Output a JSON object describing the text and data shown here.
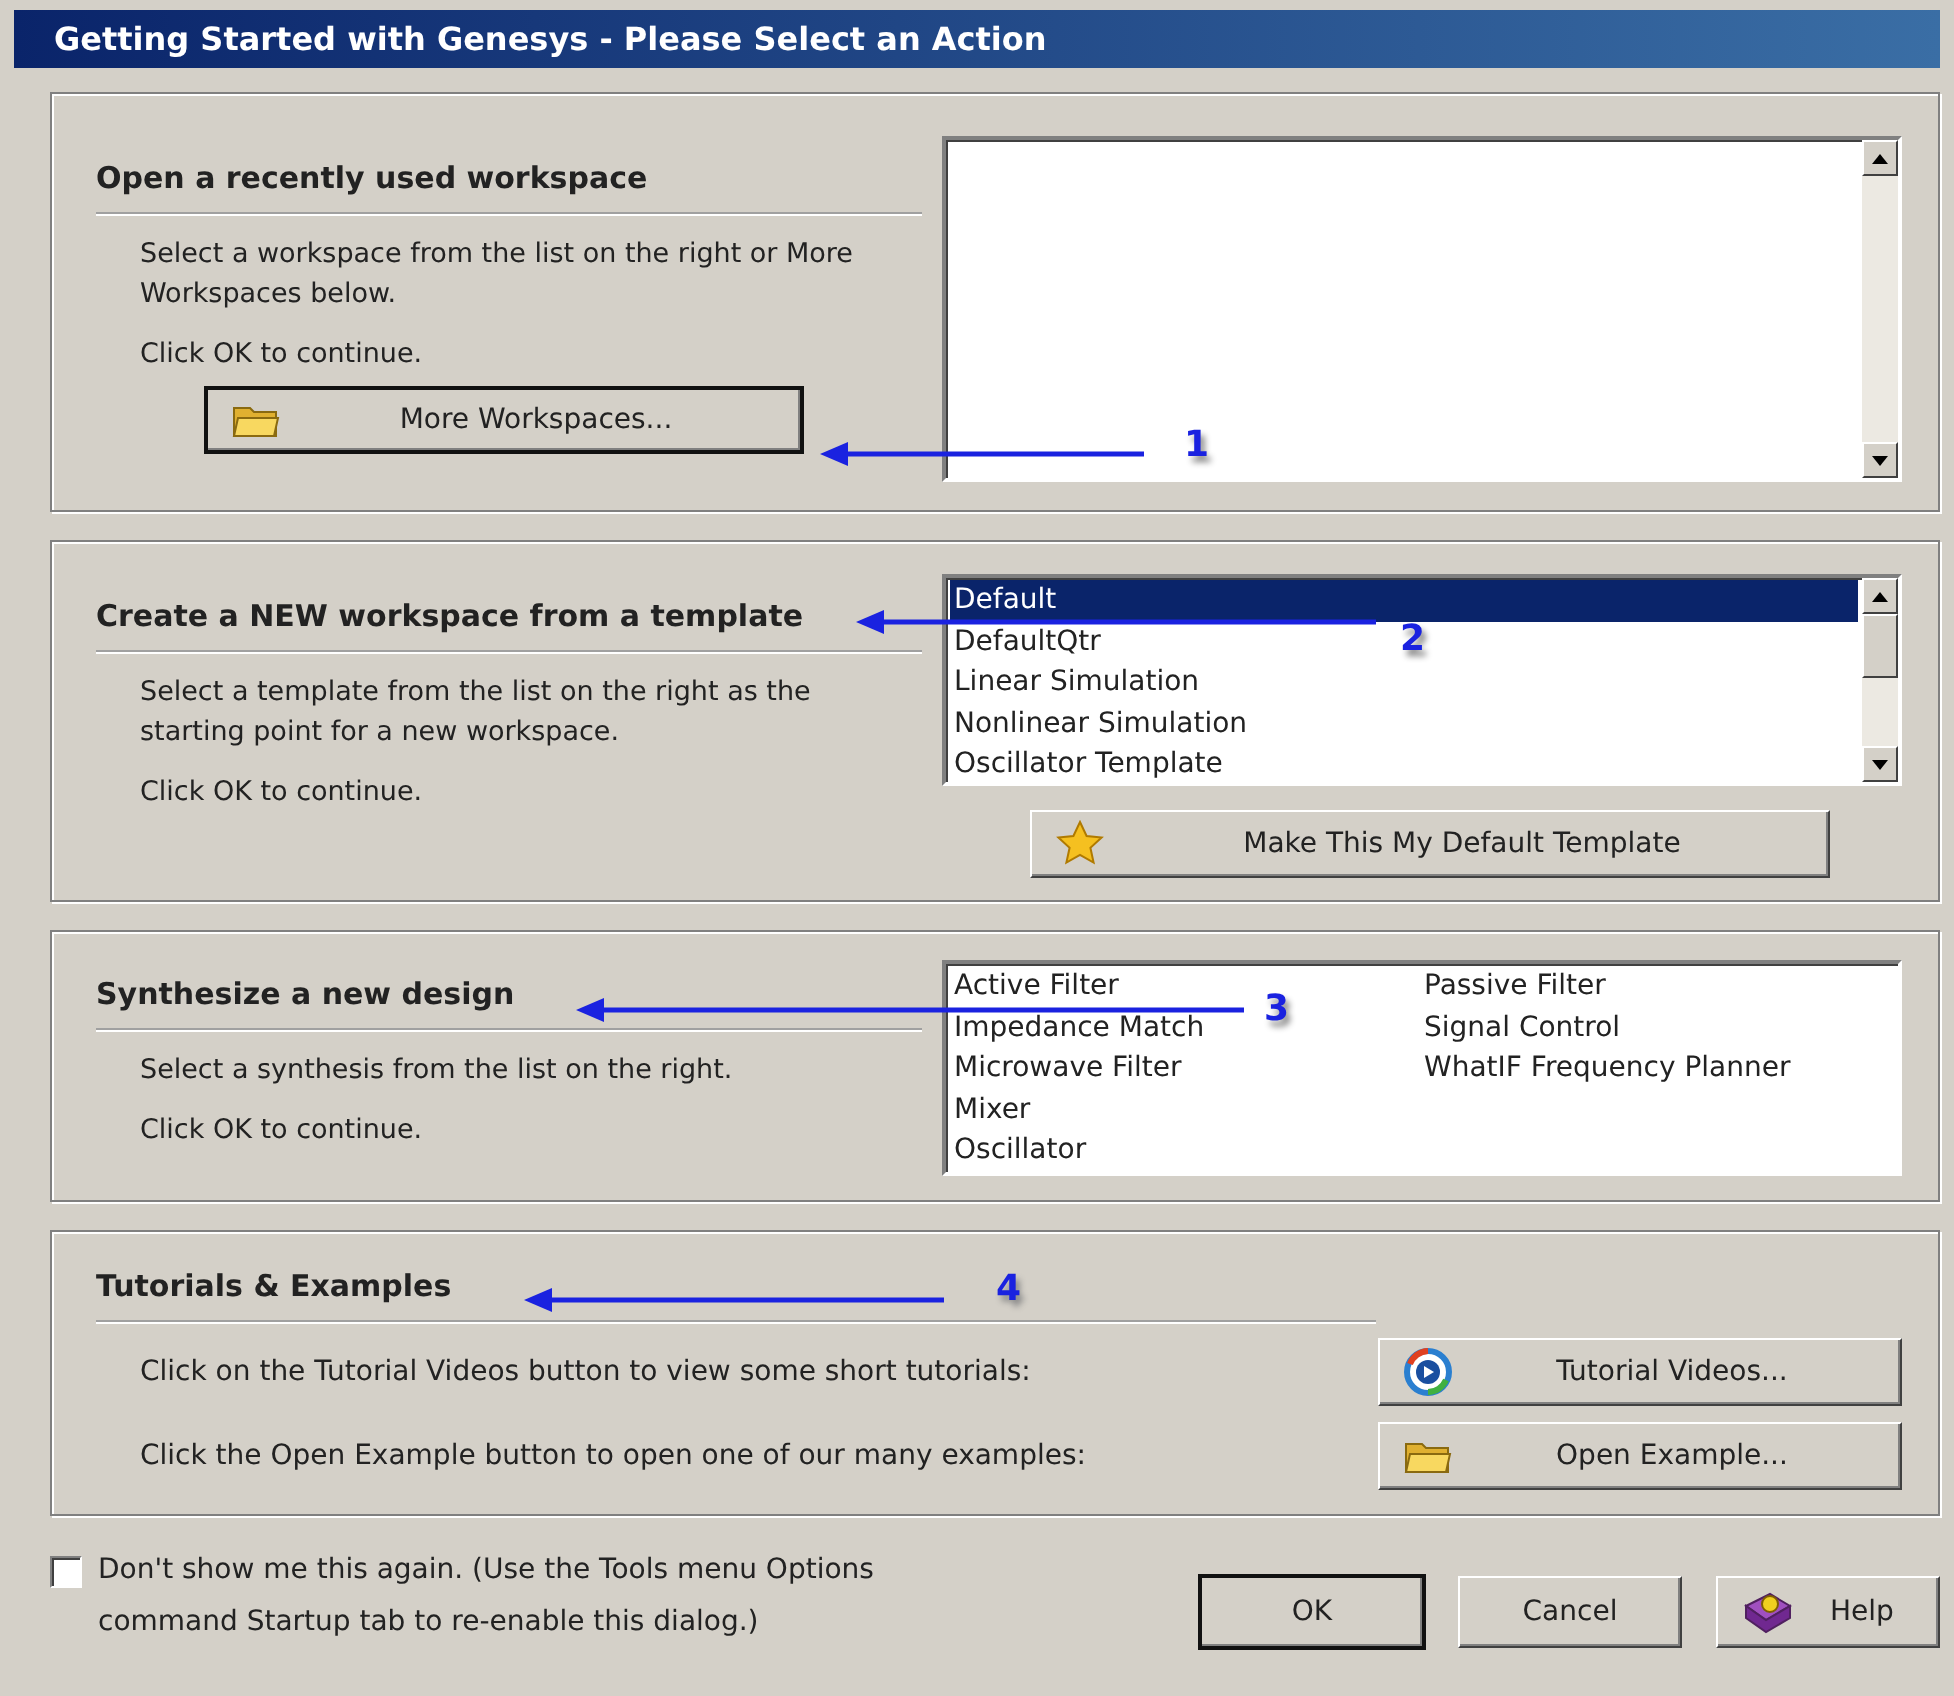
{
  "window": {
    "title": "Getting Started with Genesys - Please Select an Action"
  },
  "sections": [
    {
      "kind": "recent",
      "heading": "Open a recently used workspace",
      "lines": [
        "Select a workspace from the list on the right or More Workspaces below.",
        "Click OK to continue."
      ],
      "button": {
        "label": "More Workspaces...",
        "default": true
      },
      "annotation": "1"
    },
    {
      "kind": "template",
      "heading": "Create a NEW workspace from a template",
      "lines": [
        "Select a template from the list on the right as the starting point for a new workspace.",
        "Click OK to continue."
      ],
      "items": [
        {
          "label": "Default",
          "selected": true
        },
        {
          "label": "DefaultQtr",
          "selected": false
        },
        {
          "label": "Linear Simulation",
          "selected": false
        },
        {
          "label": "Nonlinear Simulation",
          "selected": false
        },
        {
          "label": "Oscillator Template",
          "selected": false
        }
      ],
      "button": {
        "label": "Make This My Default Template",
        "default": false
      },
      "annotation": "2"
    },
    {
      "kind": "synthesis",
      "heading": "Synthesize a new design",
      "lines": [
        "Select a synthesis from the list on the right.",
        "Click OK to continue."
      ],
      "items": [
        {
          "label": "Active Filter",
          "selected": false
        },
        {
          "label": "Impedance Match",
          "selected": false
        },
        {
          "label": "Microwave Filter",
          "selected": false
        },
        {
          "label": "Mixer",
          "selected": false
        },
        {
          "label": "Oscillator",
          "selected": false
        },
        {
          "label": "Passive Filter",
          "selected": false
        },
        {
          "label": "Signal Control",
          "selected": false
        },
        {
          "label": "WhatIF Frequency Planner",
          "selected": false
        }
      ],
      "annotation": "3"
    },
    {
      "kind": "tutorials",
      "heading": "Tutorials & Examples",
      "rows": [
        {
          "text": "Click on the Tutorial Videos button to view some short tutorials:",
          "button": {
            "label": "Tutorial Videos...",
            "default": false
          }
        },
        {
          "text": "Click the Open Example button to open one of our many examples:",
          "button": {
            "label": "Open Example...",
            "default": false
          }
        }
      ],
      "annotation": "4"
    }
  ],
  "dont_show": {
    "label": "Don't show me this again. (Use the Tools menu Options command Startup tab to re-enable this dialog.)",
    "checked": false
  },
  "buttons": [
    {
      "label": "OK",
      "default": true
    },
    {
      "label": "Cancel",
      "default": false
    },
    {
      "label": "Help",
      "default": false
    }
  ]
}
